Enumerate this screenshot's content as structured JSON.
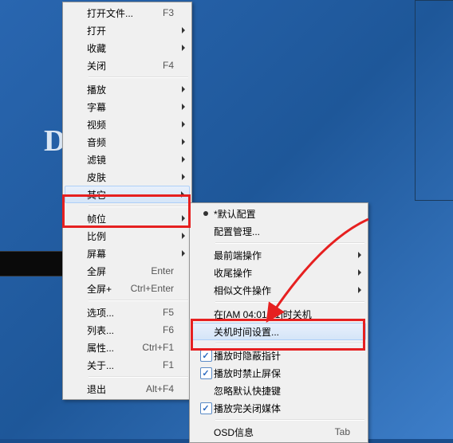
{
  "menu1": {
    "items": [
      {
        "label": "打开文件...",
        "shortcut": "F3"
      },
      {
        "label": "打开",
        "submenu": true
      },
      {
        "label": "收藏",
        "submenu": true
      },
      {
        "label": "关闭",
        "shortcut": "F4"
      },
      {
        "sep": true
      },
      {
        "label": "播放",
        "submenu": true
      },
      {
        "label": "字幕",
        "submenu": true
      },
      {
        "label": "视频",
        "submenu": true
      },
      {
        "label": "音频",
        "submenu": true
      },
      {
        "label": "滤镜",
        "submenu": true
      },
      {
        "label": "皮肤",
        "submenu": true
      },
      {
        "label": "其它",
        "submenu": true,
        "hover": true
      },
      {
        "sep": true
      },
      {
        "label": "帧位",
        "submenu": true
      },
      {
        "label": "比例",
        "submenu": true
      },
      {
        "label": "屏幕",
        "submenu": true
      },
      {
        "label": "全屏",
        "shortcut": "Enter"
      },
      {
        "label": "全屏+",
        "shortcut": "Ctrl+Enter"
      },
      {
        "sep": true
      },
      {
        "label": "选项...",
        "shortcut": "F5"
      },
      {
        "label": "列表...",
        "shortcut": "F6"
      },
      {
        "label": "属性...",
        "shortcut": "Ctrl+F1"
      },
      {
        "label": "关于...",
        "shortcut": "F1"
      },
      {
        "sep": true
      },
      {
        "label": "退出",
        "shortcut": "Alt+F4"
      }
    ]
  },
  "menu2": {
    "items": [
      {
        "label": "*默认配置",
        "radio": true
      },
      {
        "label": "配置管理..."
      },
      {
        "sep": true
      },
      {
        "label": "最前端操作",
        "submenu": true
      },
      {
        "label": "收尾操作",
        "submenu": true
      },
      {
        "label": "相似文件操作",
        "submenu": true
      },
      {
        "sep": true
      },
      {
        "label": "在[AM 04:01:01]时关机"
      },
      {
        "label": "关机时间设置...",
        "hover": true
      },
      {
        "sep": true
      },
      {
        "label": "播放时隐蔽指针",
        "check": true
      },
      {
        "label": "播放时禁止屏保",
        "check": true
      },
      {
        "label": "忽略默认快捷键"
      },
      {
        "label": "播放完关闭媒体",
        "check": true
      },
      {
        "sep": true
      },
      {
        "label": "OSD信息",
        "shortcut": "Tab"
      }
    ]
  },
  "bg_letter": "D"
}
